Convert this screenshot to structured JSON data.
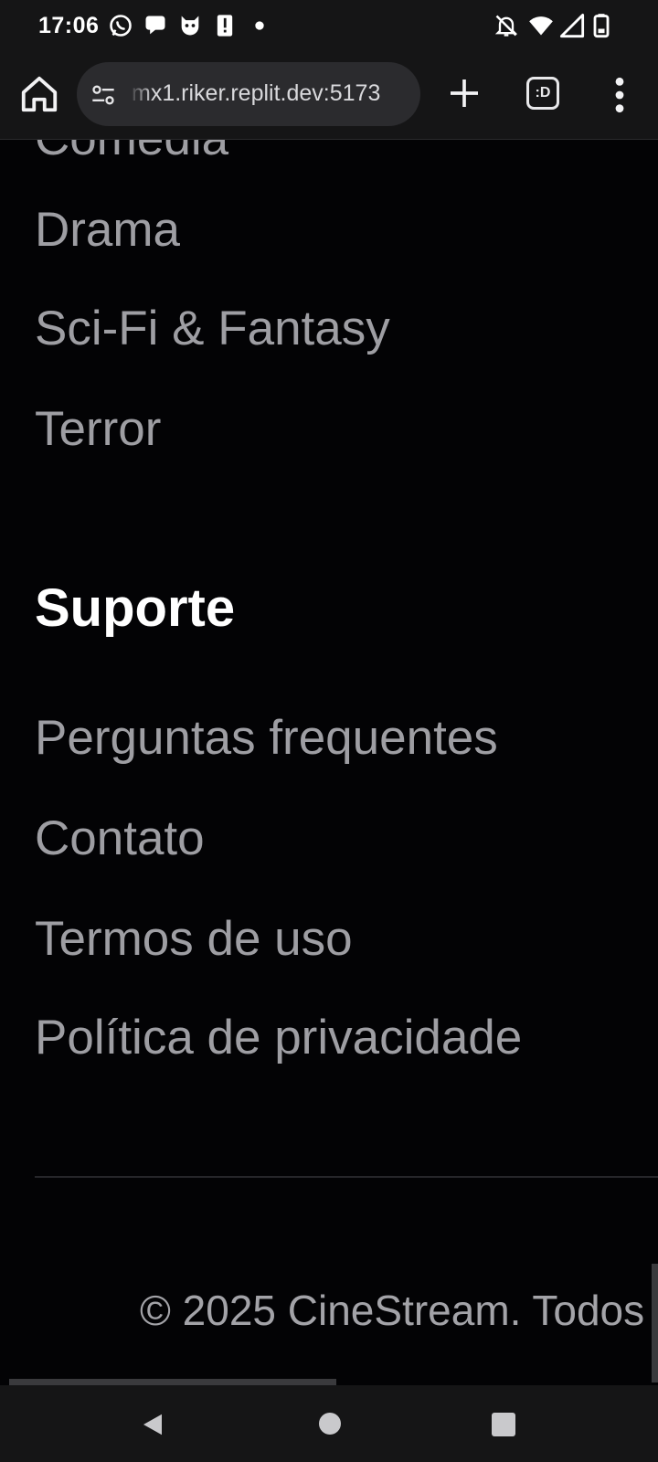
{
  "status_bar": {
    "time": "17:06",
    "left_icons": [
      "whatsapp-icon",
      "chat-bubble-icon",
      "cat-face-icon",
      "alert-icon",
      "dot-icon"
    ],
    "right_icons": [
      "bell-off-icon",
      "wifi-icon",
      "signal-icon",
      "battery-icon"
    ]
  },
  "browser": {
    "url": "mx1.riker.replit.dev:5173",
    "tab_count": ":D",
    "icons": [
      "home-icon",
      "site-settings-icon",
      "new-tab-icon",
      "tab-switcher-icon",
      "more-menu-icon"
    ]
  },
  "footer": {
    "partial_link": "Comédia",
    "genre_links": [
      {
        "label": "Drama"
      },
      {
        "label": "Sci-Fi & Fantasy"
      },
      {
        "label": "Terror"
      }
    ],
    "support_heading": "Suporte",
    "support_links": [
      {
        "label": "Perguntas frequentes"
      },
      {
        "label": "Contato"
      },
      {
        "label": "Termos de uso"
      },
      {
        "label": "Política de privacidade"
      }
    ],
    "copyright": "© 2025 CineStream. Todos"
  },
  "nav_bar": {
    "icons": [
      "back-icon",
      "home-circle-icon",
      "recents-icon"
    ]
  },
  "colors": {
    "page_background": "#030305",
    "link_text": "#9e9ea3",
    "heading_text": "#ffffff",
    "chrome_background": "#151516"
  }
}
